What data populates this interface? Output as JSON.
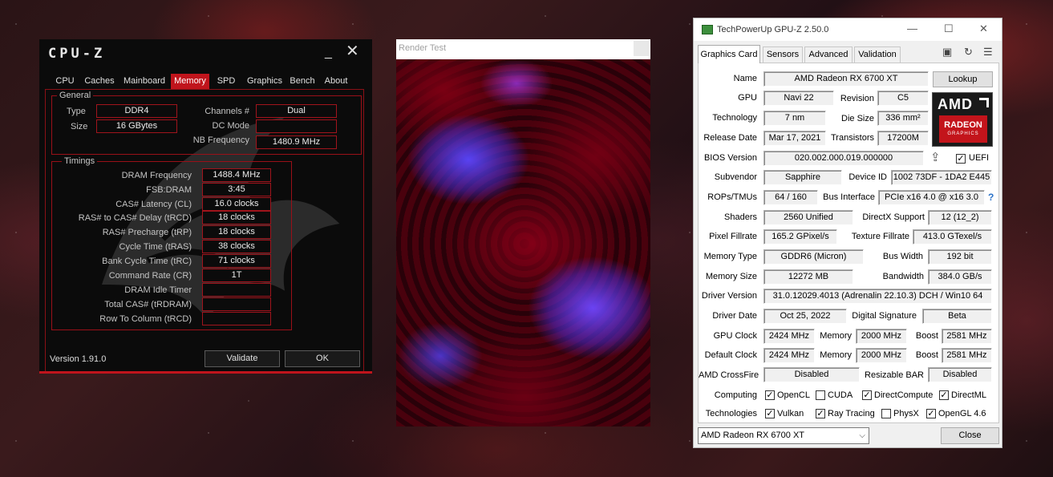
{
  "cpuz": {
    "title": "CPU-Z",
    "tabs": [
      "CPU",
      "Caches",
      "Mainboard",
      "Memory",
      "SPD",
      "Graphics",
      "Bench",
      "About"
    ],
    "active_tab": "Memory",
    "general": {
      "label": "General",
      "type_label": "Type",
      "type_value": "DDR4",
      "size_label": "Size",
      "size_value": "16 GBytes",
      "channels_label": "Channels #",
      "channels_value": "Dual",
      "dc_mode_label": "DC Mode",
      "dc_mode_value": "",
      "nb_freq_label": "NB Frequency",
      "nb_freq_value": "1480.9 MHz"
    },
    "timings": {
      "label": "Timings",
      "rows": [
        {
          "label": "DRAM Frequency",
          "value": "1488.4 MHz"
        },
        {
          "label": "FSB:DRAM",
          "value": "3:45"
        },
        {
          "label": "CAS# Latency (CL)",
          "value": "16.0 clocks"
        },
        {
          "label": "RAS# to CAS# Delay (tRCD)",
          "value": "18 clocks"
        },
        {
          "label": "RAS# Precharge (tRP)",
          "value": "18 clocks"
        },
        {
          "label": "Cycle Time (tRAS)",
          "value": "38 clocks"
        },
        {
          "label": "Bank Cycle Time (tRC)",
          "value": "71 clocks"
        },
        {
          "label": "Command Rate (CR)",
          "value": "1T"
        },
        {
          "label": "DRAM Idle Timer",
          "value": ""
        },
        {
          "label": "Total CAS# (tRDRAM)",
          "value": ""
        },
        {
          "label": "Row To Column (tRCD)",
          "value": ""
        }
      ]
    },
    "version": "Version 1.91.0",
    "validate_label": "Validate",
    "ok_label": "OK"
  },
  "render": {
    "title": "Render Test"
  },
  "gpuz": {
    "title": "TechPowerUp GPU-Z 2.50.0",
    "tabs": [
      "Graphics Card",
      "Sensors",
      "Advanced",
      "Validation"
    ],
    "active_tab": "Graphics Card",
    "lookup_label": "Lookup",
    "fields": {
      "name_label": "Name",
      "name_value": "AMD Radeon RX 6700 XT",
      "gpu_label": "GPU",
      "gpu_value": "Navi 22",
      "revision_label": "Revision",
      "revision_value": "C5",
      "technology_label": "Technology",
      "technology_value": "7 nm",
      "die_size_label": "Die Size",
      "die_size_value": "336 mm²",
      "release_label": "Release Date",
      "release_value": "Mar 17, 2021",
      "transistors_label": "Transistors",
      "transistors_value": "17200M",
      "bios_label": "BIOS Version",
      "bios_value": "020.002.000.019.000000",
      "uefi_label": "UEFI",
      "uefi_checked": true,
      "subvendor_label": "Subvendor",
      "subvendor_value": "Sapphire",
      "device_id_label": "Device ID",
      "device_id_value": "1002 73DF - 1DA2 E445",
      "rops_label": "ROPs/TMUs",
      "rops_value": "64 / 160",
      "bus_if_label": "Bus Interface",
      "bus_if_value": "PCIe x16 4.0 @ x16 3.0",
      "shaders_label": "Shaders",
      "shaders_value": "2560 Unified",
      "dx_label": "DirectX Support",
      "dx_value": "12 (12_2)",
      "pixel_label": "Pixel Fillrate",
      "pixel_value": "165.2 GPixel/s",
      "texture_label": "Texture Fillrate",
      "texture_value": "413.0 GTexel/s",
      "memtype_label": "Memory Type",
      "memtype_value": "GDDR6 (Micron)",
      "buswidth_label": "Bus Width",
      "buswidth_value": "192 bit",
      "memsize_label": "Memory Size",
      "memsize_value": "12272 MB",
      "bandwidth_label": "Bandwidth",
      "bandwidth_value": "384.0 GB/s",
      "driver_ver_label": "Driver Version",
      "driver_ver_value": "31.0.12029.4013 (Adrenalin 22.10.3) DCH / Win10 64",
      "driver_date_label": "Driver Date",
      "driver_date_value": "Oct 25, 2022",
      "sig_label": "Digital Signature",
      "sig_value": "Beta",
      "gpu_clock_label": "GPU Clock",
      "gpu_clock_value": "2424 MHz",
      "mem_label": "Memory",
      "mem_value": "2000 MHz",
      "boost_label": "Boost",
      "boost_value": "2581 MHz",
      "def_clock_label": "Default Clock",
      "def_clock_value": "2424 MHz",
      "def_mem_label": "Memory",
      "def_mem_value": "2000 MHz",
      "def_boost_label": "Boost",
      "def_boost_value": "2581 MHz",
      "crossfire_label": "AMD CrossFire",
      "crossfire_value": "Disabled",
      "rebar_label": "Resizable BAR",
      "rebar_value": "Disabled"
    },
    "computing_label": "Computing",
    "computing": [
      {
        "label": "OpenCL",
        "checked": true
      },
      {
        "label": "CUDA",
        "checked": false
      },
      {
        "label": "DirectCompute",
        "checked": true
      },
      {
        "label": "DirectML",
        "checked": true
      }
    ],
    "technologies_label": "Technologies",
    "technologies": [
      {
        "label": "Vulkan",
        "checked": true
      },
      {
        "label": "Ray Tracing",
        "checked": true
      },
      {
        "label": "PhysX",
        "checked": false
      },
      {
        "label": "OpenGL 4.6",
        "checked": true
      }
    ],
    "amd_logo_text": "AMD",
    "radeon_text": "RADEON",
    "graphics_text": "GRAPHICS",
    "device_select": "AMD Radeon RX 6700 XT",
    "close_label": "Close"
  }
}
